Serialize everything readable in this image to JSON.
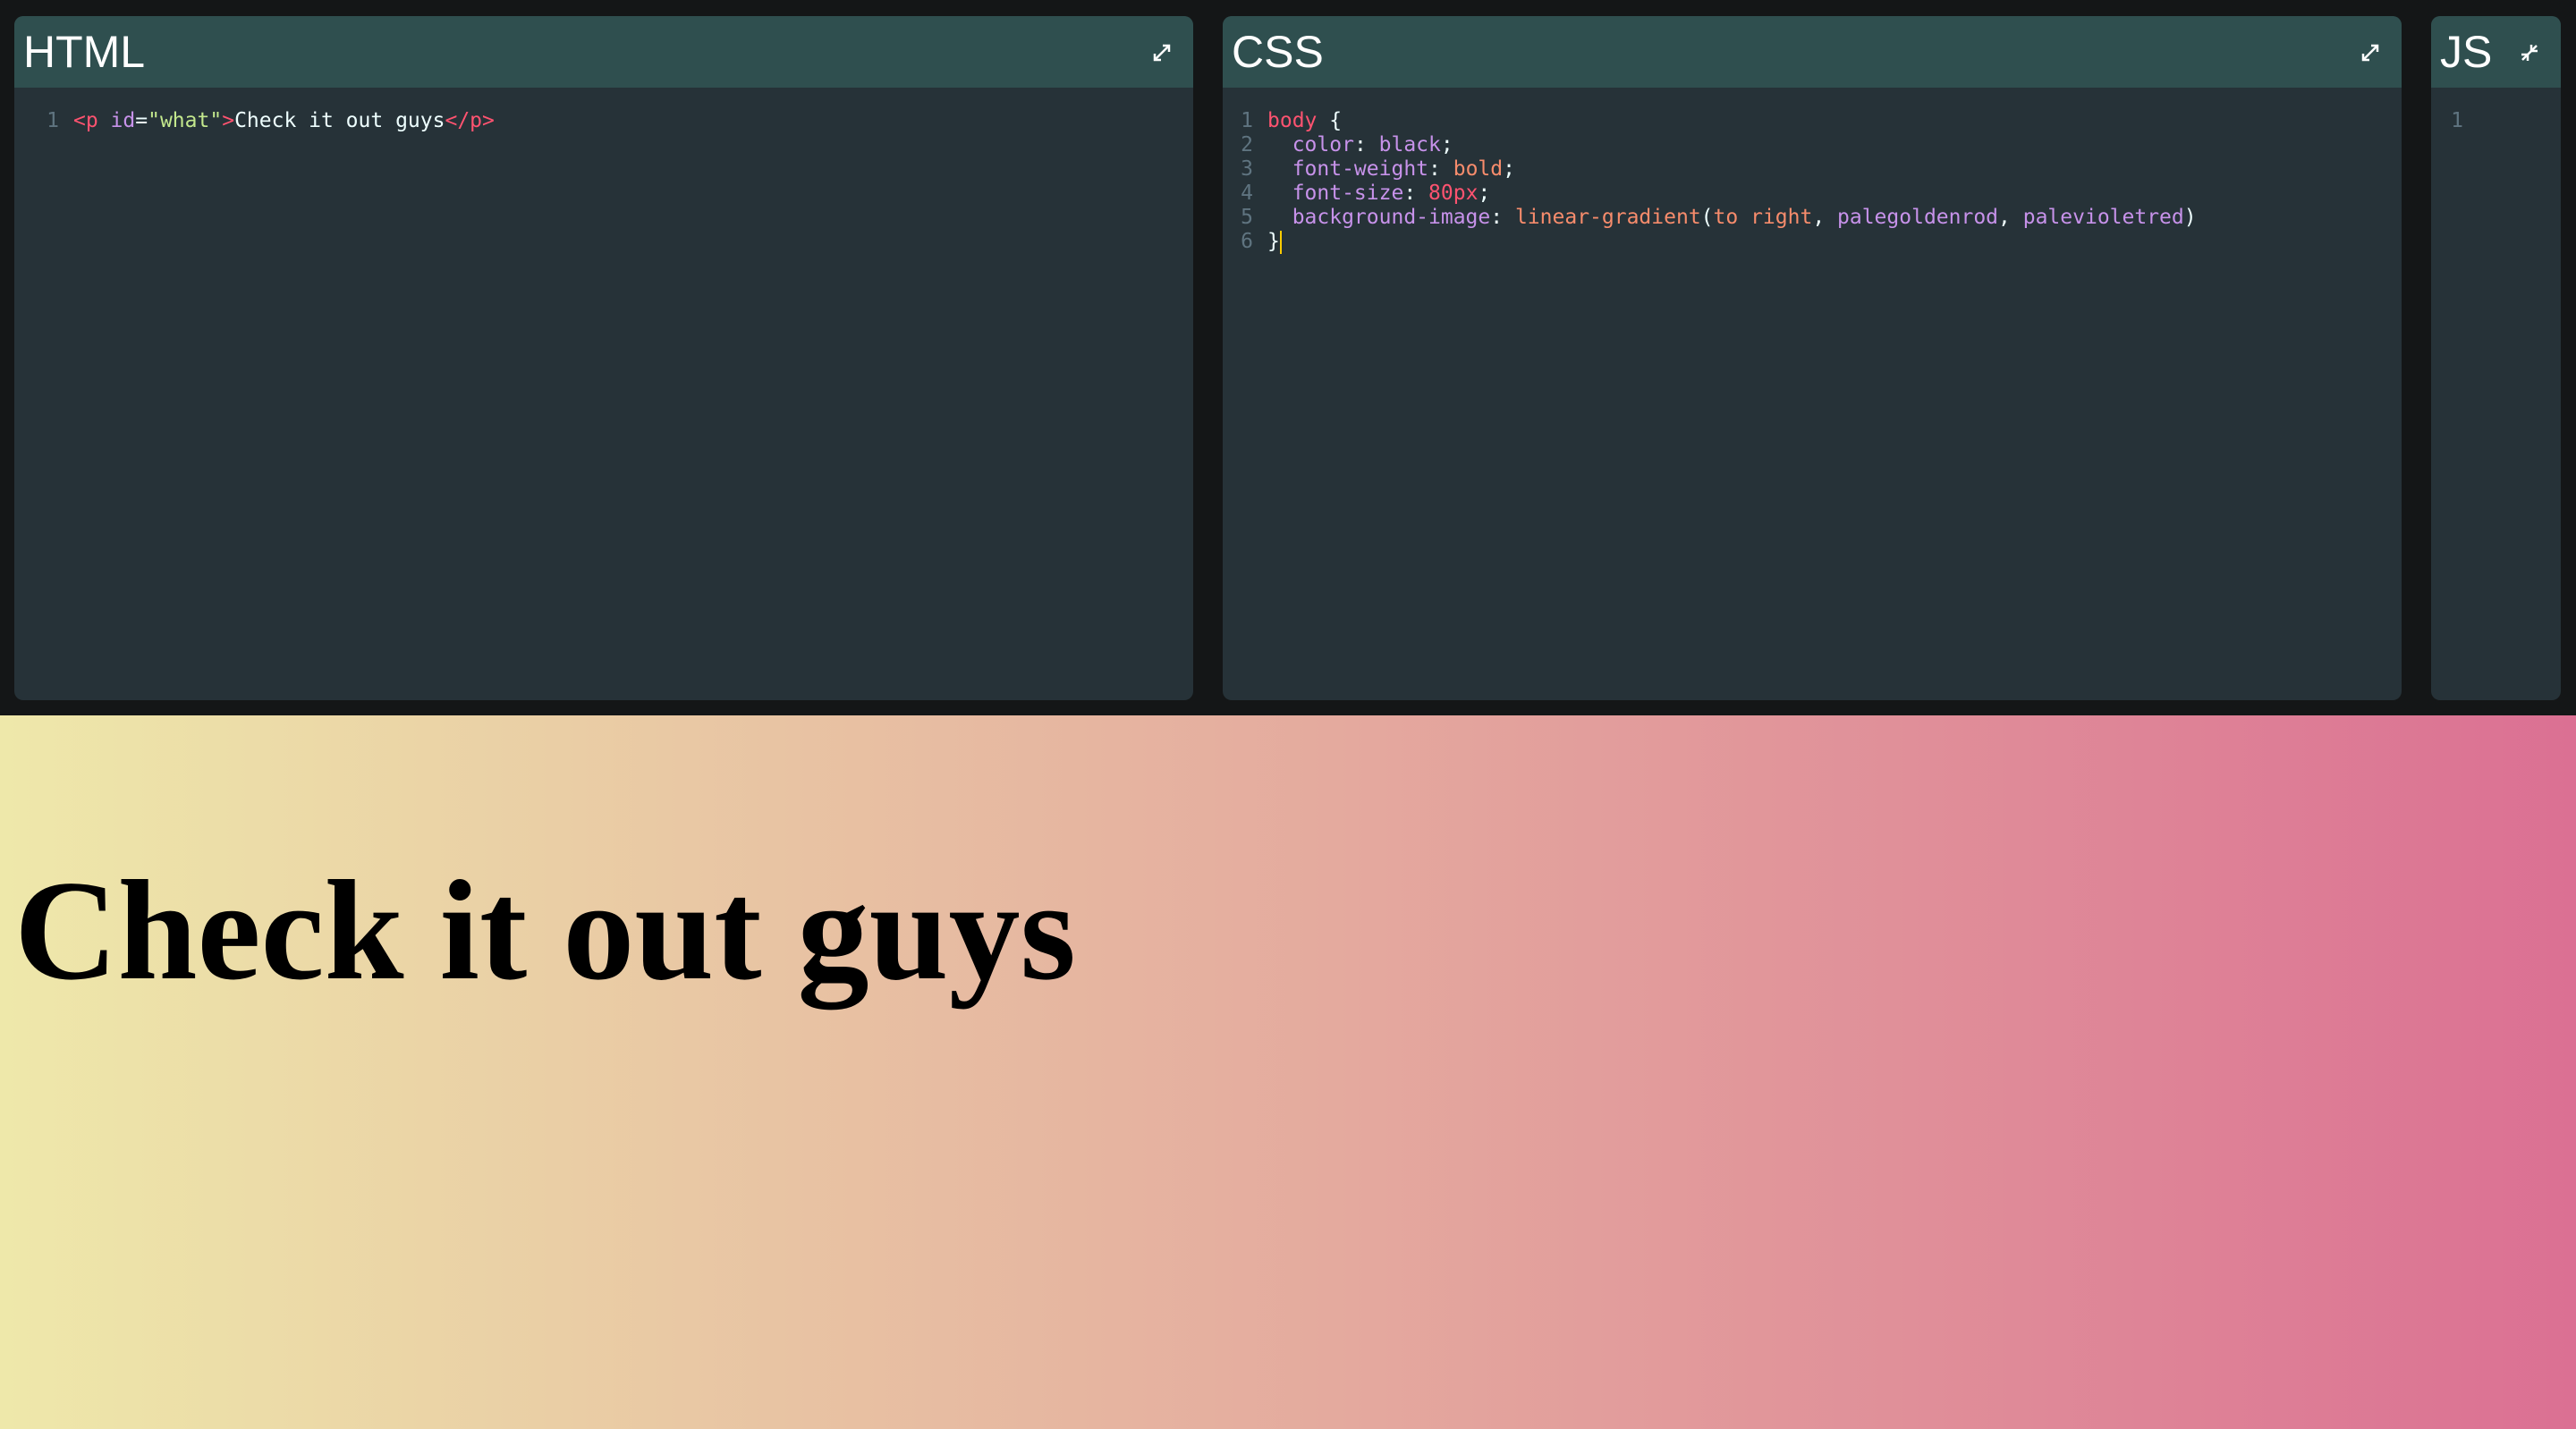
{
  "panes": {
    "html": {
      "title": "HTML",
      "expand_icon": "expand-icon",
      "lines": [
        {
          "num": "1",
          "tokens": [
            {
              "t": "<p ",
              "c": "t-tag"
            },
            {
              "t": "id",
              "c": "t-attr"
            },
            {
              "t": "=",
              "c": "t-punc"
            },
            {
              "t": "\"what\"",
              "c": "t-str"
            },
            {
              "t": ">",
              "c": "t-tag"
            },
            {
              "t": "Check it out guys",
              "c": "t-text"
            },
            {
              "t": "</p>",
              "c": "t-tag"
            }
          ]
        }
      ]
    },
    "css": {
      "title": "CSS",
      "expand_icon": "expand-icon",
      "lines": [
        {
          "num": "1",
          "tokens": [
            {
              "t": "body",
              "c": "t-sel"
            },
            {
              "t": " {",
              "c": "t-punc"
            }
          ]
        },
        {
          "num": "2",
          "tokens": [
            {
              "t": "  color",
              "c": "t-prop"
            },
            {
              "t": ": ",
              "c": "t-punc"
            },
            {
              "t": "black",
              "c": "t-kw"
            },
            {
              "t": ";",
              "c": "t-punc"
            }
          ]
        },
        {
          "num": "3",
          "tokens": [
            {
              "t": "  font-weight",
              "c": "t-prop"
            },
            {
              "t": ": ",
              "c": "t-punc"
            },
            {
              "t": "bold",
              "c": "t-val"
            },
            {
              "t": ";",
              "c": "t-punc"
            }
          ]
        },
        {
          "num": "4",
          "tokens": [
            {
              "t": "  font-size",
              "c": "t-prop"
            },
            {
              "t": ": ",
              "c": "t-punc"
            },
            {
              "t": "80px",
              "c": "t-num"
            },
            {
              "t": ";",
              "c": "t-punc"
            }
          ]
        },
        {
          "num": "5",
          "tokens": [
            {
              "t": "  background-image",
              "c": "t-prop"
            },
            {
              "t": ": ",
              "c": "t-punc"
            },
            {
              "t": "linear-gradient",
              "c": "t-fn"
            },
            {
              "t": "(",
              "c": "t-punc"
            },
            {
              "t": "to right",
              "c": "t-val"
            },
            {
              "t": ", ",
              "c": "t-punc"
            },
            {
              "t": "palegoldenrod",
              "c": "t-kw"
            },
            {
              "t": ", ",
              "c": "t-punc"
            },
            {
              "t": "palevioletred",
              "c": "t-kw"
            },
            {
              "t": ")",
              "c": "t-punc"
            }
          ]
        },
        {
          "num": "6",
          "tokens": [
            {
              "t": "}",
              "c": "t-punc"
            }
          ],
          "cursor": true
        }
      ]
    },
    "js": {
      "title": "JS",
      "collapse_icon": "collapse-icon",
      "lines": [
        {
          "num": "1",
          "tokens": []
        }
      ]
    }
  },
  "preview": {
    "text": "Check it out guys"
  },
  "colors": {
    "editor_bg": "#263238",
    "header_bg": "#2f4f4f",
    "outer_bg": "#141617",
    "gradient_start": "palegoldenrod",
    "gradient_end": "palevioletred"
  }
}
